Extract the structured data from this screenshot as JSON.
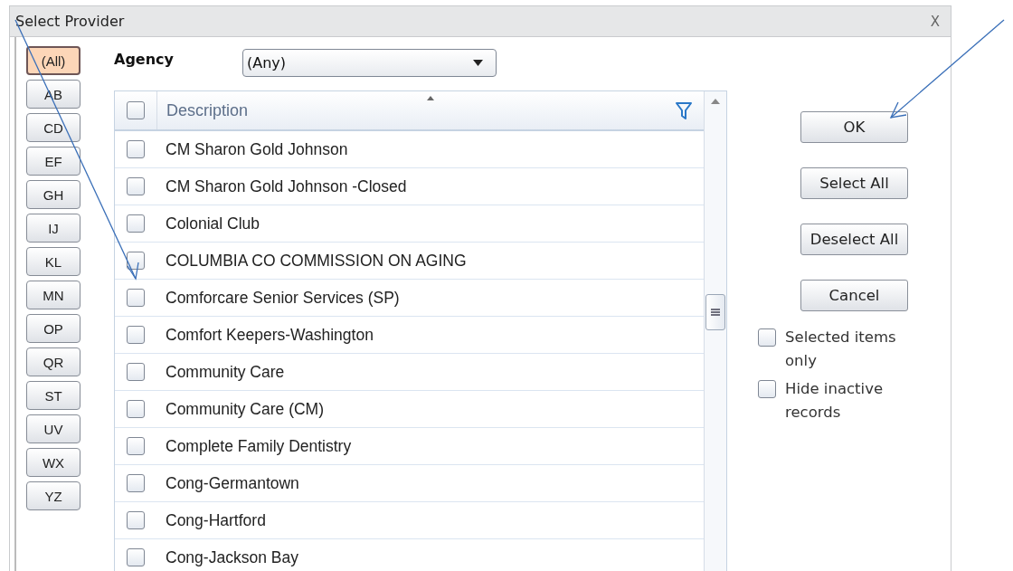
{
  "window": {
    "title": "Select Provider",
    "close": "X"
  },
  "letter_filters": [
    {
      "label": "(All)",
      "selected": true
    },
    {
      "label": "AB",
      "selected": false
    },
    {
      "label": "CD",
      "selected": false
    },
    {
      "label": "EF",
      "selected": false
    },
    {
      "label": "GH",
      "selected": false
    },
    {
      "label": "IJ",
      "selected": false
    },
    {
      "label": "KL",
      "selected": false
    },
    {
      "label": "MN",
      "selected": false
    },
    {
      "label": "OP",
      "selected": false
    },
    {
      "label": "QR",
      "selected": false
    },
    {
      "label": "ST",
      "selected": false
    },
    {
      "label": "UV",
      "selected": false
    },
    {
      "label": "WX",
      "selected": false
    },
    {
      "label": "YZ",
      "selected": false
    }
  ],
  "agency": {
    "label": "Agency",
    "value": "(Any)"
  },
  "table": {
    "header_checked": false,
    "columns": [
      "Description"
    ],
    "rows": [
      {
        "description": "CM Sharon Gold Johnson",
        "checked": false
      },
      {
        "description": "CM Sharon Gold Johnson -Closed",
        "checked": false
      },
      {
        "description": "Colonial Club",
        "checked": false
      },
      {
        "description": "COLUMBIA CO COMMISSION ON AGING",
        "checked": false
      },
      {
        "description": "Comforcare Senior Services (SP)",
        "checked": false
      },
      {
        "description": "Comfort Keepers-Washington",
        "checked": false
      },
      {
        "description": "Community Care",
        "checked": false
      },
      {
        "description": "Community Care (CM)",
        "checked": false
      },
      {
        "description": "Complete Family Dentistry",
        "checked": false
      },
      {
        "description": "Cong-Germantown",
        "checked": false
      },
      {
        "description": "Cong-Hartford",
        "checked": false
      },
      {
        "description": "Cong-Jackson Bay",
        "checked": false
      }
    ]
  },
  "buttons": [
    "OK",
    "Select All",
    "Deselect All",
    "Cancel"
  ],
  "options": [
    {
      "label": "Selected items only",
      "checked": false
    },
    {
      "label": "Hide inactive records",
      "checked": false
    }
  ]
}
